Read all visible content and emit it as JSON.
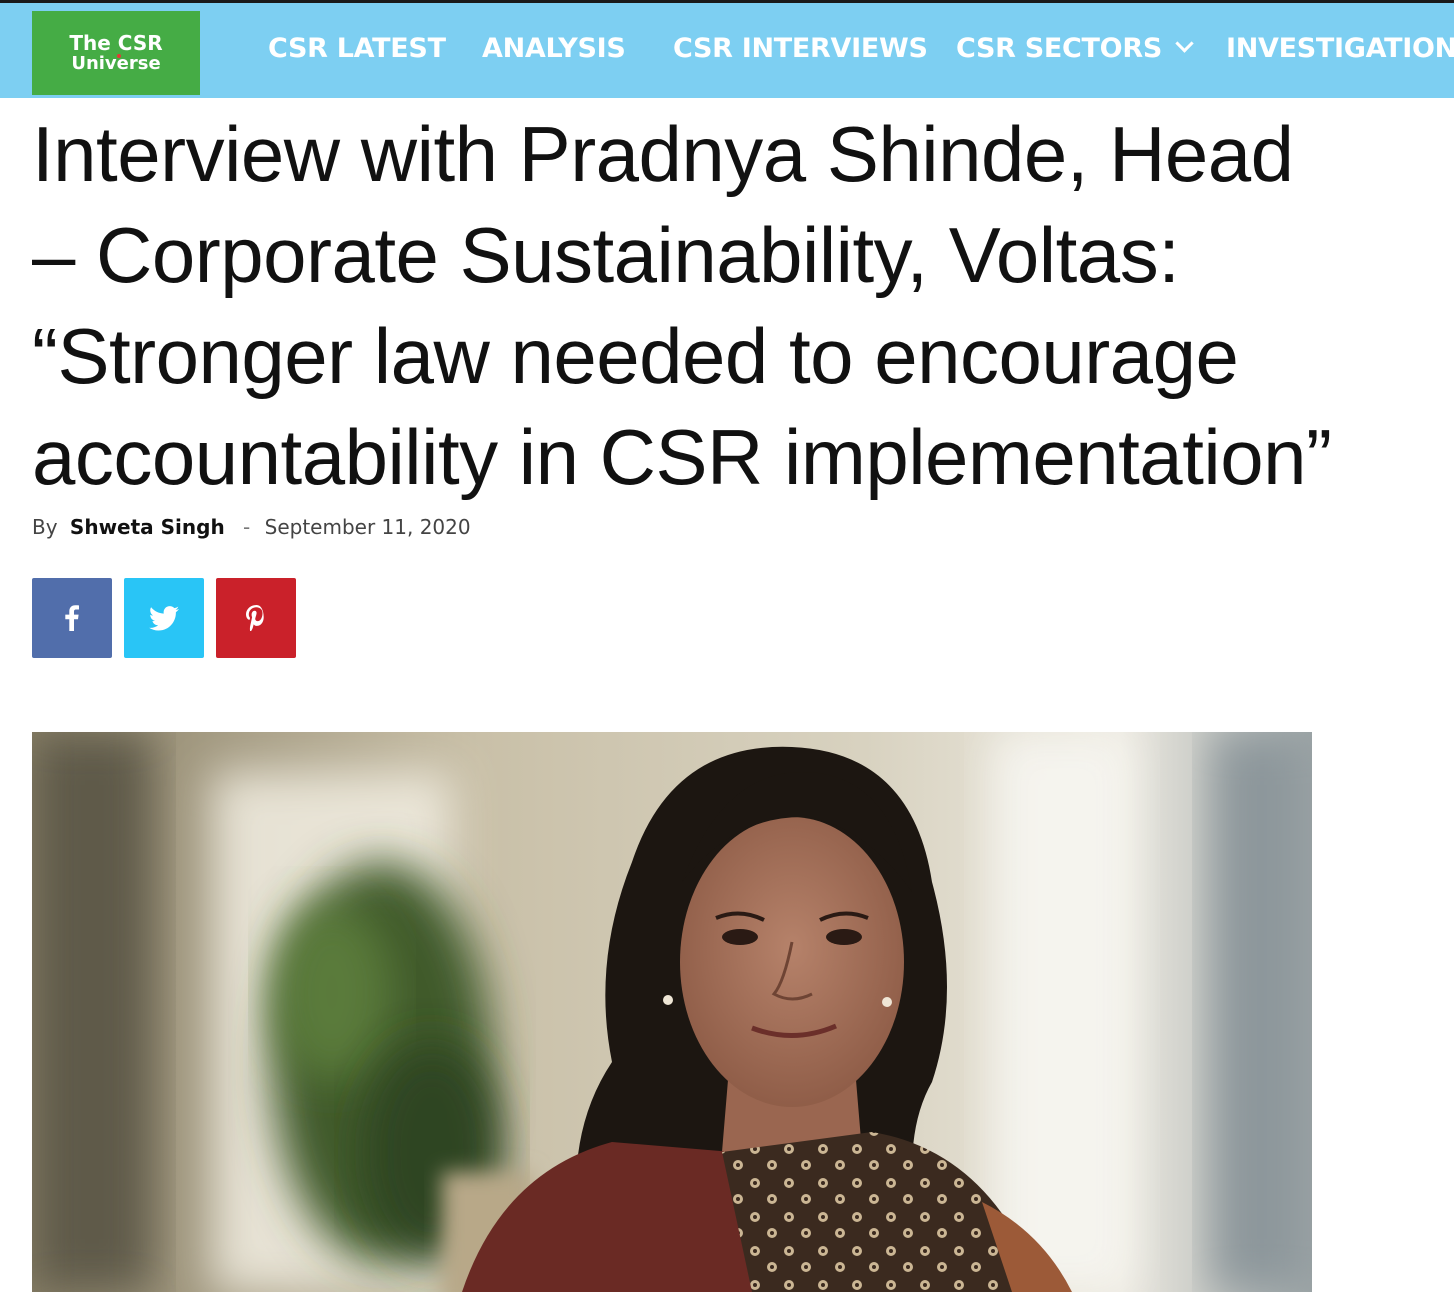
{
  "site": {
    "logo_line1": "The CSR",
    "logo_line2": "Universe",
    "brand_color": "#45ac45",
    "header_color": "#7dcff2"
  },
  "nav": {
    "items": [
      {
        "label": "CSR LATEST"
      },
      {
        "label": "ANALYSIS"
      },
      {
        "label": "CSR INTERVIEWS"
      },
      {
        "label": "CSR SECTORS",
        "has_dropdown": true
      },
      {
        "label": "INVESTIGATION"
      }
    ]
  },
  "article": {
    "title_lines": [
      "Interview with Pradnya Shinde, Head",
      "– Corporate Sustainability, Voltas:",
      "“Stronger law needed to encourage",
      "accountability in CSR implementation”"
    ],
    "by_label": "By",
    "author": "Shweta Singh",
    "separator": "-",
    "date": "September 11, 2020"
  },
  "share": {
    "buttons": [
      {
        "network": "facebook",
        "icon": "facebook-icon",
        "color": "#516eab"
      },
      {
        "network": "twitter",
        "icon": "twitter-icon",
        "color": "#29c5f6"
      },
      {
        "network": "pinterest",
        "icon": "pinterest-icon",
        "color": "#ca212a"
      }
    ]
  },
  "hero_image": {
    "subject": "portrait-photo"
  }
}
